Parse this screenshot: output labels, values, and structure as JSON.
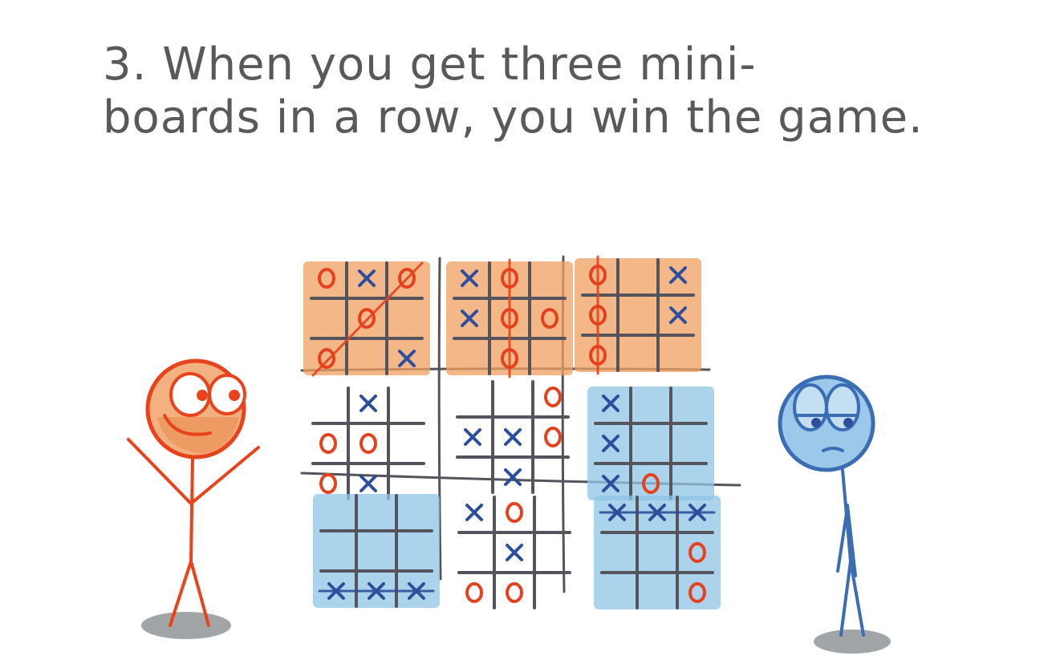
{
  "caption": {
    "line1": "3. When you get three mini-",
    "line2": "boards in a row, you win the game."
  },
  "colors": {
    "text": "#59595b",
    "grid": "#55535b",
    "orange_mark": "#e6411f",
    "orange_fill": "#f0a060",
    "blue_mark": "#2d4f9b",
    "blue_fill": "#8fc6e6",
    "winner_figure": "#e8431c",
    "loser_figure": "#3a6db4",
    "shadow": "#8a8e92"
  },
  "game": {
    "winner": "O",
    "boards": [
      {
        "owner": "O",
        "cells": [
          "O",
          "X",
          "O",
          "",
          "O",
          "",
          "O",
          "",
          "X"
        ],
        "strike": "diag-rising"
      },
      {
        "owner": "O",
        "cells": [
          "X",
          "O",
          "",
          "X",
          "O",
          "O",
          "",
          "O",
          ""
        ],
        "strike": "col-2"
      },
      {
        "owner": "O",
        "cells": [
          "O",
          "",
          "X",
          "O",
          "",
          "X",
          "O",
          "",
          ""
        ],
        "strike": "col-1"
      },
      {
        "owner": "",
        "cells": [
          "",
          "X",
          "",
          "O",
          "O",
          "",
          "O",
          "X",
          ""
        ],
        "strike": ""
      },
      {
        "owner": "",
        "cells": [
          "",
          "",
          "O",
          "X",
          "X",
          "O",
          "",
          "X",
          ""
        ],
        "strike": ""
      },
      {
        "owner": "X",
        "cells": [
          "X",
          "",
          "",
          "X",
          "",
          "",
          "X",
          "O",
          ""
        ],
        "strike": ""
      },
      {
        "owner": "X",
        "cells": [
          "",
          "",
          "",
          "",
          "",
          "",
          "X",
          "X",
          "X"
        ],
        "strike": "row-3"
      },
      {
        "owner": "",
        "cells": [
          "X",
          "O",
          "",
          "",
          "X",
          "",
          "O",
          "O",
          ""
        ],
        "strike": ""
      },
      {
        "owner": "X",
        "cells": [
          "X",
          "X",
          "X",
          "",
          "",
          "O",
          "",
          "",
          "O"
        ],
        "strike": "row-1"
      }
    ]
  }
}
